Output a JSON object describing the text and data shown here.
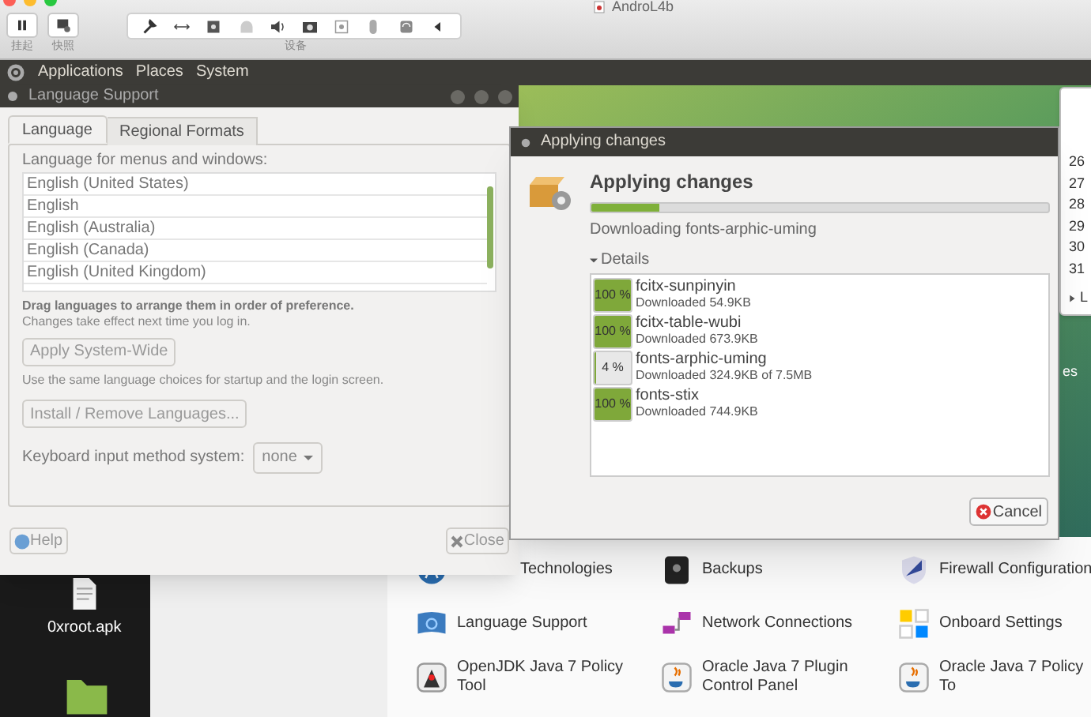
{
  "host_window": {
    "title": "AndroL4b",
    "buttons": [
      {
        "label": "挂起"
      },
      {
        "label": "快照"
      }
    ],
    "device_group_label": "设备"
  },
  "top_panel": {
    "menus": [
      "Applications",
      "Places",
      "System"
    ]
  },
  "language_support": {
    "title": "Language Support",
    "tabs": [
      {
        "label": "Language",
        "selected": true
      },
      {
        "label": "Regional Formats",
        "selected": false
      }
    ],
    "list_label": "Language for menus and windows:",
    "languages": [
      "English (United States)",
      "English",
      "English (Australia)",
      "English (Canada)",
      "English (United Kingdom)"
    ],
    "hint_bold": "Drag languages to arrange them in order of preference.",
    "hint": "Changes take effect next time you log in.",
    "apply_button": "Apply System-Wide",
    "apply_note": "Use the same language choices for startup and the login screen.",
    "install_button": "Install / Remove Languages...",
    "input_method_label": "Keyboard input method system:",
    "input_method_value": "none",
    "help_button": "Help",
    "close_button": "Close"
  },
  "applying_dialog": {
    "title": "Applying changes",
    "heading": "Applying changes",
    "level": 0.15,
    "status": "Downloading fonts-arphic-uming",
    "details_label": "Details",
    "details_expanded": true,
    "packages": [
      {
        "percent": "100 %",
        "level": 1,
        "name": "fcitx-sunpinyin",
        "info": "Downloaded 54.9KB"
      },
      {
        "percent": "100 %",
        "level": 1,
        "name": "fcitx-table-wubi",
        "info": "Downloaded 673.9KB"
      },
      {
        "percent": "4 %",
        "level": 0.04,
        "name": "fonts-arphic-uming",
        "info": "Downloaded 324.9KB of 7.5MB"
      },
      {
        "percent": "100 %",
        "level": 1,
        "name": "fonts-stix",
        "info": "Downloaded 744.9KB"
      }
    ],
    "cancel_button": "Cancel"
  },
  "calendar": {
    "days": [
      "26",
      "27",
      "28",
      "29",
      "30",
      "31"
    ],
    "footer": "L"
  },
  "fragment": "es",
  "desktop": {
    "files": [
      "0xroot.apk"
    ]
  },
  "settings": {
    "items": [
      {
        "label": "Technologies"
      },
      {
        "label": "Backups"
      },
      {
        "label": "Firewall Configuration"
      },
      {
        "label": "Language Support"
      },
      {
        "label": "Network Connections"
      },
      {
        "label": "Onboard Settings"
      },
      {
        "label": "OpenJDK Java 7 Policy Tool"
      },
      {
        "label": "Oracle Java 7 Plugin Control Panel"
      },
      {
        "label": "Oracle Java 7 Policy To"
      }
    ]
  }
}
